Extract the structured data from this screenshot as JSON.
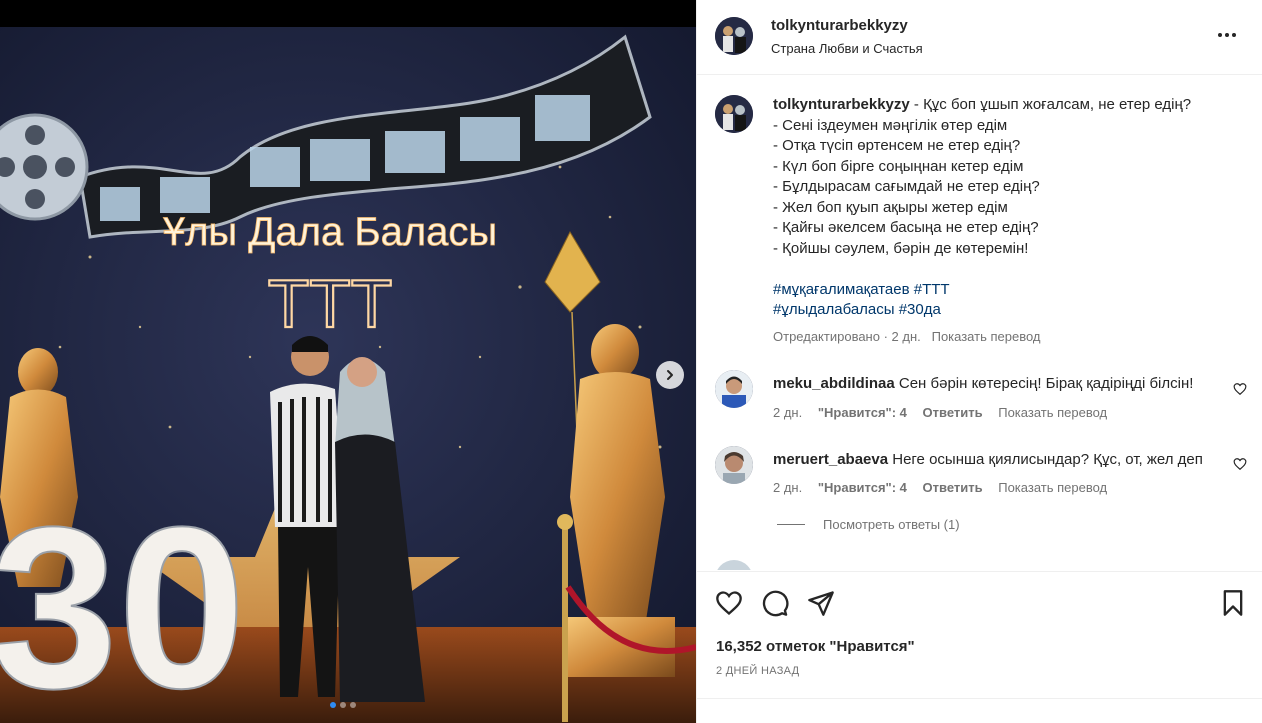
{
  "post": {
    "username": "tolkynturarbekkyzy",
    "location": "Страна Любви и Счастья",
    "photo_text": {
      "sign": "Ұлы Дала Баласы",
      "ttt": "ТТТ",
      "number": "30"
    },
    "carousel": {
      "slides": 3,
      "active": 1
    }
  },
  "caption": {
    "username": "tolkynturarbekkyzy",
    "lines": [
      " - Құс боп ұшып жоғалсам, не етер едің?",
      "- Сені іздеумен мәңгілік өтер едім",
      "- Отқа түсіп өртенсем не етер едің?",
      "- Күл боп бірге соңыңнан кетер едім",
      "- Бұлдырасам сағымдай не етер едің?",
      "- Жел боп қуып ақыры жетер едім",
      "- Қайғы әкелсем басыңа не етер едің?",
      "- Қойшы сәулем, бәрін де көтеремін!"
    ],
    "hashtags_line1": "#мұқағалимақатаев #ТТТ",
    "hashtags_line2": "#ұлыдалабаласы #30да",
    "edited": "Отредактировано · 2 дн.",
    "translate": "Показать перевод"
  },
  "comments": [
    {
      "username": "meku_abdildinaa",
      "text": " Сен бәрін көтересің! Бірақ қадіріңді білсін!",
      "time": "2 дн.",
      "likes": "\"Нравится\": 4",
      "reply": "Ответить",
      "translate": "Показать перевод"
    },
    {
      "username": "meruert_abaeva",
      "text": " Неге осынша қиялисындар? Құс, от, жел деп",
      "time": "2 дн.",
      "likes": "\"Нравится\": 4",
      "reply": "Ответить",
      "translate": "Показать перевод"
    }
  ],
  "view_replies": "Посмотреть ответы (1)",
  "likes_count": "16,352 отметок \"Нравится\"",
  "post_date": "2 ДНЕЙ НАЗАД",
  "icons": [
    "more-options-icon",
    "heart-icon",
    "comment-icon",
    "share-icon",
    "bookmark-icon",
    "chevron-right-icon"
  ],
  "colors": {
    "link": "#00376b",
    "muted": "#737373",
    "text": "#262626",
    "dot_active": "#2f8cf3"
  }
}
